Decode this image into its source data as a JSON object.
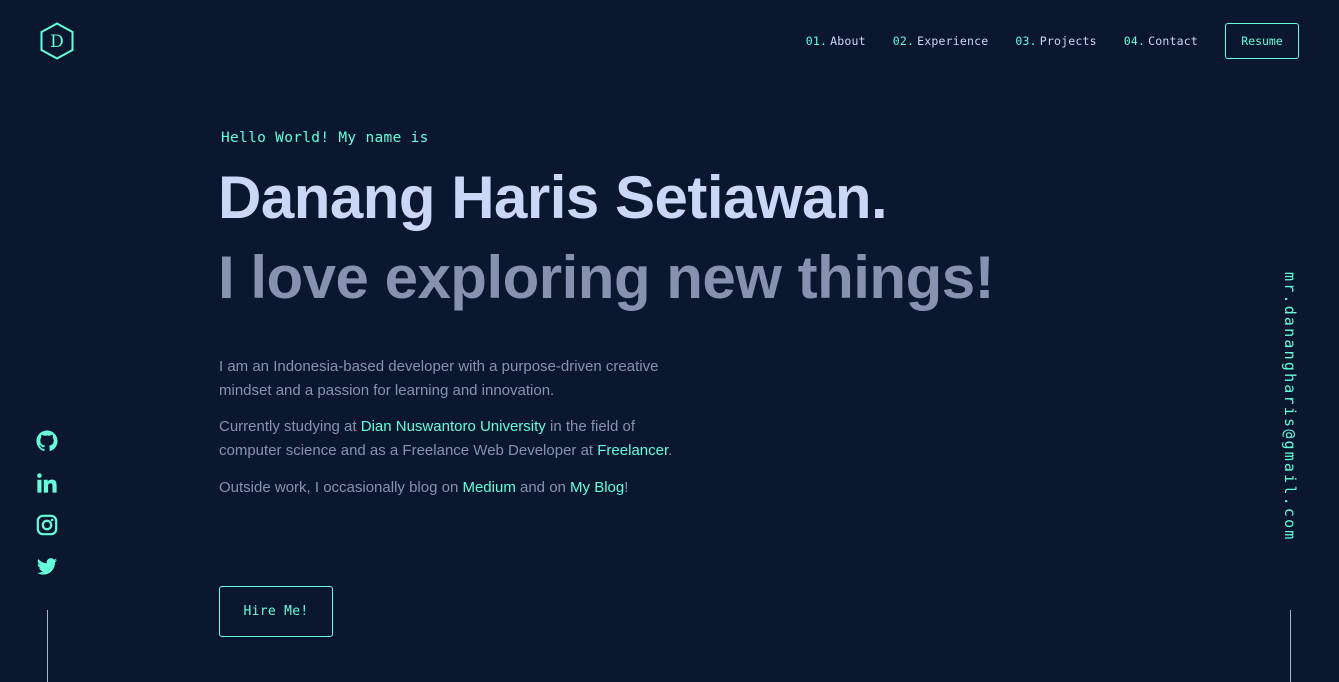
{
  "logo": {
    "letter": "D",
    "icon": "hexagon-logo-icon"
  },
  "nav": {
    "items": [
      {
        "num": "01.",
        "label": "About"
      },
      {
        "num": "02.",
        "label": "Experience"
      },
      {
        "num": "03.",
        "label": "Projects"
      },
      {
        "num": "04.",
        "label": "Contact"
      }
    ],
    "resume_label": "Resume"
  },
  "hero": {
    "greeting": "Hello World! My name is",
    "name": "Danang Haris Setiawan.",
    "tagline": "I love exploring new things!",
    "bio": {
      "p1": "I am an Indonesia-based developer with a purpose-driven creative mindset and a passion for learning and innovation.",
      "p2_a": "Currently studying at ",
      "p2_link1": "Dian Nuswantoro University",
      "p2_b": " in the field of computer science and as a Freelance Web Developer at ",
      "p2_link2": "Freelancer",
      "p2_c": ".",
      "p3_a": "Outside work, I occasionally blog on ",
      "p3_link1": "Medium",
      "p3_b": " and on ",
      "p3_link2": "My Blog",
      "p3_c": "!"
    },
    "hire_label": "Hire Me!"
  },
  "socials": [
    "github-icon",
    "linkedin-icon",
    "instagram-icon",
    "twitter-icon"
  ],
  "email": "mr.dananghar is@gmail.com",
  "colors": {
    "background": "#0b172e",
    "accent": "#64ffda",
    "heading": "#ccd6f6",
    "text": "#8892b0"
  }
}
